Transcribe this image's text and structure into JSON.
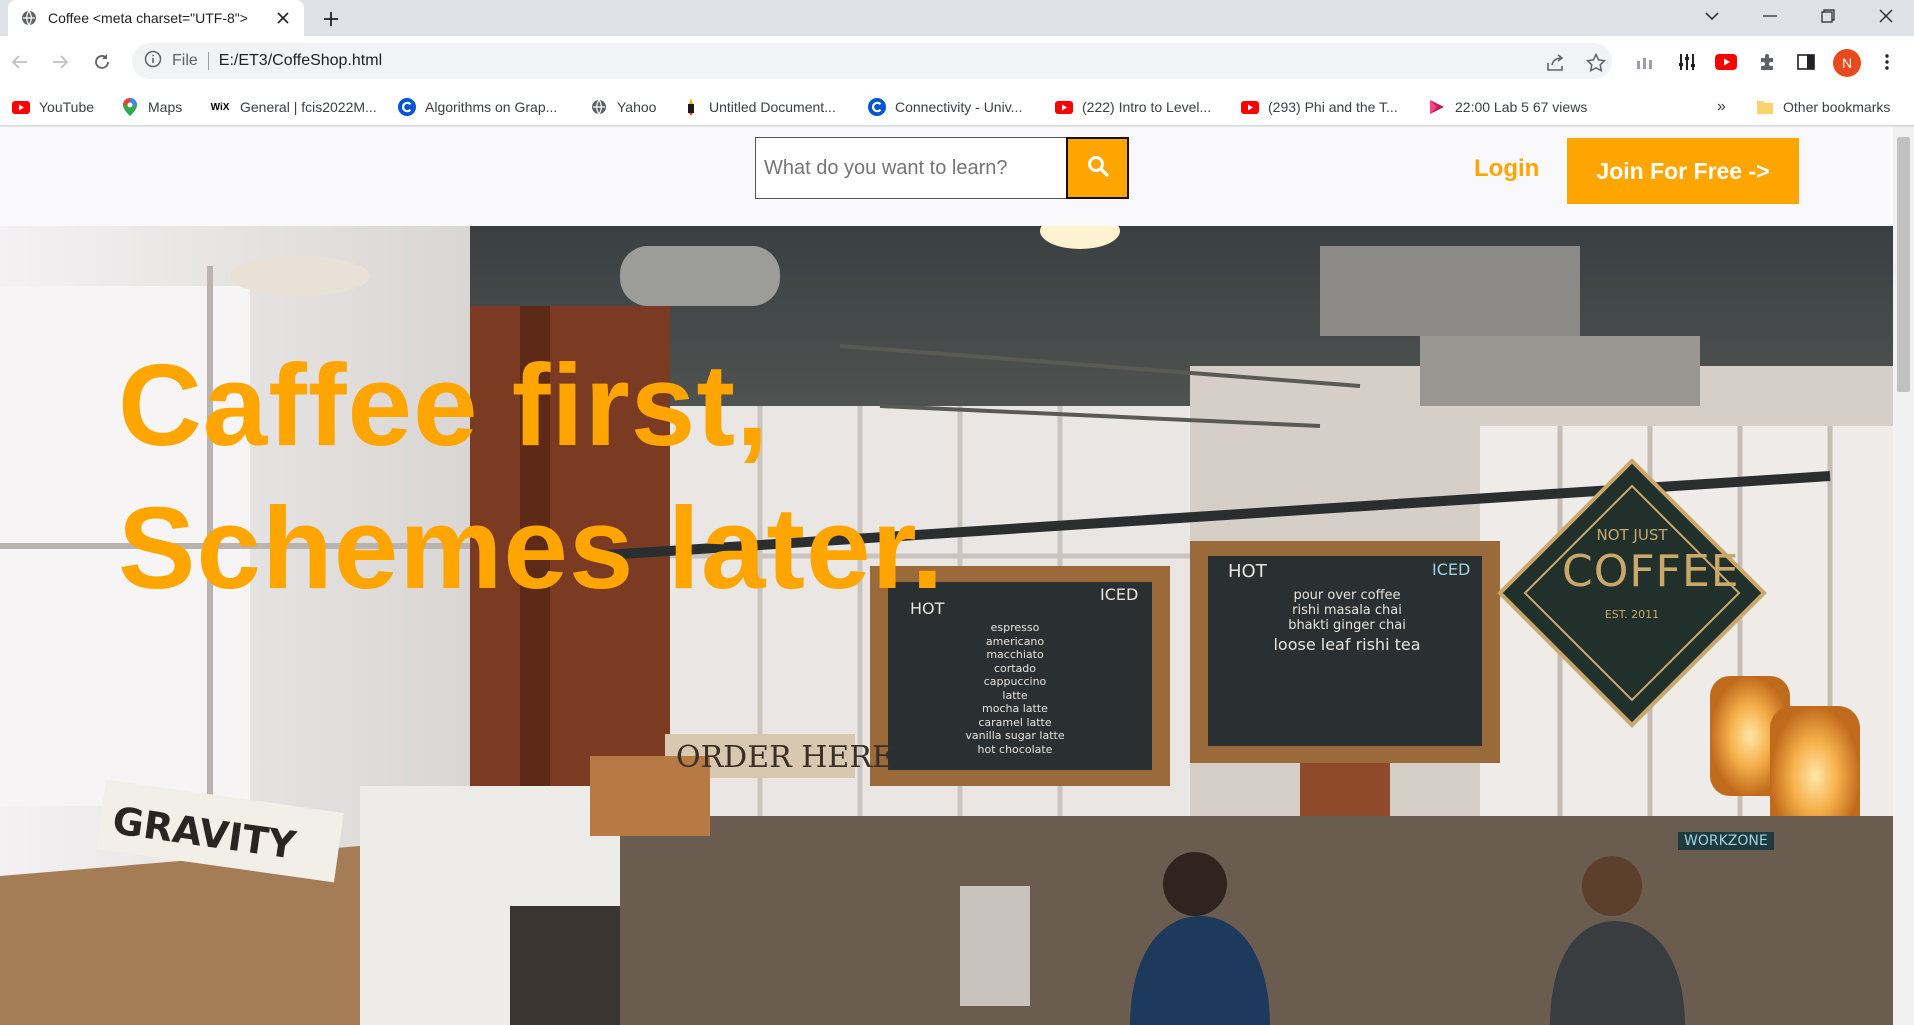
{
  "browser": {
    "tab_title": "Coffee <meta charset=\"UTF-8\">",
    "address_prefix": "File",
    "url": "E:/ET3/CoffeShop.html",
    "profile_initial": "N"
  },
  "bookmarks": [
    {
      "label": "YouTube",
      "icon": "youtube-icon"
    },
    {
      "label": "Maps",
      "icon": "maps-icon"
    },
    {
      "label": "General | fcis2022M...",
      "icon": "wix-icon"
    },
    {
      "label": "Algorithms on Grap...",
      "icon": "coursera-icon"
    },
    {
      "label": "Yahoo",
      "icon": "globe-icon"
    },
    {
      "label": "Untitled Document...",
      "icon": "doc-icon"
    },
    {
      "label": "Connectivity - Univ...",
      "icon": "coursera-icon"
    },
    {
      "label": "(222) Intro to Level...",
      "icon": "youtube-icon"
    },
    {
      "label": "(293) Phi and the T...",
      "icon": "youtube-icon"
    },
    {
      "label": "22:00 Lab 5 67 views",
      "icon": "play-icon"
    }
  ],
  "bookmarks_overflow": "»",
  "other_bookmarks": "Other bookmarks",
  "site": {
    "search_placeholder": "What do you want to learn?",
    "login": "Login",
    "join": "Join For Free ->",
    "hero_line1": "Caffee first,",
    "hero_line2": "Schemes later."
  },
  "hero_scene": {
    "menu_left_hot": "HOT",
    "menu_left_iced": "ICED",
    "menu_left_items": [
      "espresso",
      "americano",
      "macchiato",
      "cortado",
      "cappuccino",
      "latte",
      "mocha latte",
      "caramel latte",
      "vanilla sugar latte",
      "hot chocolate"
    ],
    "menu_right_hot": "HOT",
    "menu_right_iced": "ICED",
    "menu_right_items": [
      "pour over coffee",
      "rishi masala chai",
      "bhakti ginger chai",
      "loose leaf rishi tea"
    ],
    "sign_top": "NOT JUST",
    "sign_main": "COFFEE",
    "sign_bottom": "EST. 2011",
    "order_sign": "ORDER HERE",
    "crate_text": "GRAVITY",
    "workzone": "WORKZONE"
  },
  "colors": {
    "accent": "#ffa500",
    "page_bg": "#f9f9fb"
  }
}
